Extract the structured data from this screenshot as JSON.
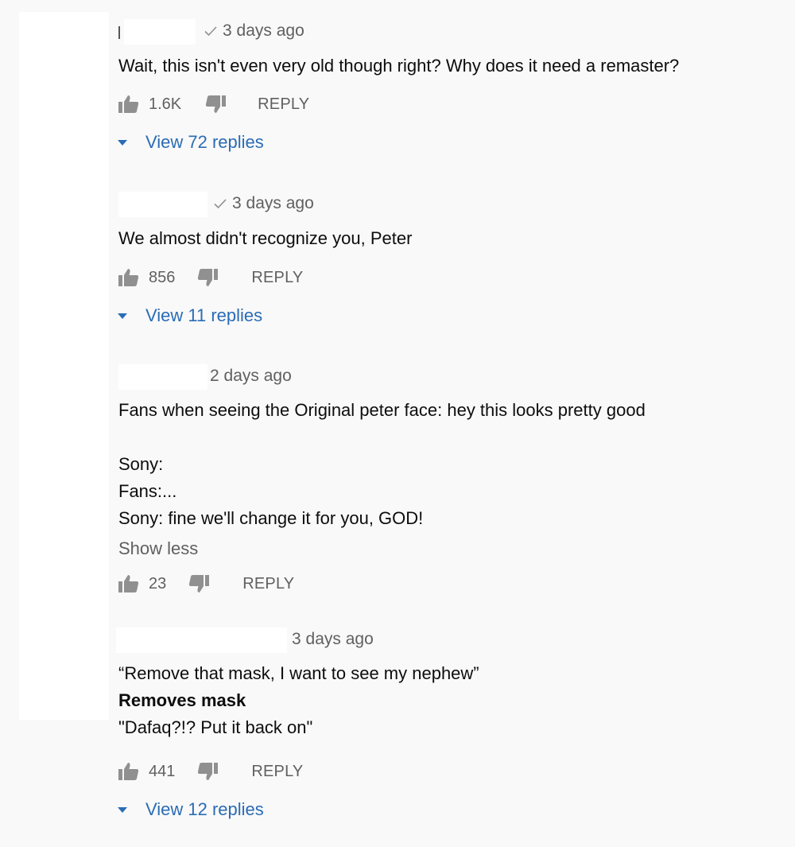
{
  "comments": [
    {
      "time": "3 days ago",
      "verified": true,
      "text_lines": [
        "Wait, this isn't even very old though right? Why does it need a remaster?"
      ],
      "likes": "1.6K",
      "reply_label": "REPLY",
      "view_replies": "View 72 replies"
    },
    {
      "time": "3 days ago",
      "verified": true,
      "text_lines": [
        "We almost didn't recognize you, Peter"
      ],
      "likes": "856",
      "reply_label": "REPLY",
      "view_replies": "View 11 replies"
    },
    {
      "time": "2 days ago",
      "verified": false,
      "text_lines": [
        "Fans when seeing the Original peter face: hey this looks pretty good",
        "",
        "Sony:",
        "Fans:...",
        "Sony: fine we'll change it for you, GOD!"
      ],
      "show_less": "Show less",
      "likes": "23",
      "reply_label": "REPLY"
    },
    {
      "time": "3 days ago",
      "verified": false,
      "text_lines": [
        "“Remove that mask, I want to see my nephew”",
        "Removes mask",
        "\"Dafaq?!? Put it back on\""
      ],
      "likes": "441",
      "reply_label": "REPLY",
      "view_replies": "View 12 replies"
    }
  ],
  "icons": {
    "like": "thumbs-up-icon",
    "dislike": "thumbs-down-icon",
    "verified": "check-icon",
    "expand": "triangle-down-icon"
  },
  "colors": {
    "background": "#f9f9f9",
    "link": "#2a6cb5",
    "secondary_text": "#606060",
    "icon": "#909090"
  }
}
